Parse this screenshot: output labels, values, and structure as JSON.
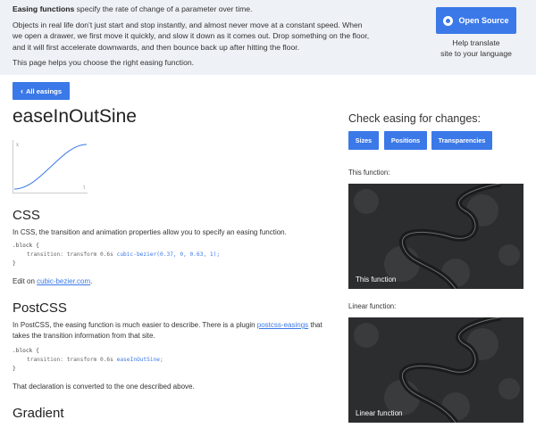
{
  "header": {
    "intro_bold": "Easing functions",
    "intro_rest": " specify the rate of change of a parameter over time.",
    "para1": "Objects in real life don’t just start and stop instantly, and almost never move at a constant speed. When we open a drawer, we first move it quickly, and slow it down as it comes out. Drop something on the floor, and it will first accelerate downwards, and then bounce back up after hitting the floor.",
    "para2": "This page helps you choose the right easing function.",
    "open_source_label": "Open Source",
    "github_icon": "github-icon",
    "translate_line1": "Help translate",
    "translate_line2": "site to your language"
  },
  "nav": {
    "back_label": "All easings",
    "back_icon": "chevron-left-icon"
  },
  "page_title": "easeInOutSine",
  "graph": {
    "x_label": "x",
    "t_label": "t",
    "curve_color": "#3b79e8"
  },
  "css": {
    "heading": "CSS",
    "text": "In CSS, the transition and animation properties allow you to specify an easing function.",
    "code_line1": ".block {",
    "code_line2_prop": "transition: transform 0.6s ",
    "code_line2_fn": "cubic-bezier(0.37, 0, 0.63, 1);",
    "code_line3": "}",
    "edit_prefix": "Edit on ",
    "edit_link": "cubic-bezier.com",
    "edit_suffix": "."
  },
  "postcss": {
    "heading": "PostCSS",
    "text_prefix": "In PostCSS, the easing function is much easier to describe. There is a plugin ",
    "plugin_link": "postcss-easings",
    "text_suffix": " that takes the transition information from that site.",
    "code_line1": ".block {",
    "code_line2_prop": "transition: transform 0.6s ",
    "code_line2_fn": "easeInOutSine;",
    "code_line3": "}",
    "after": "That declaration is converted to the one described above."
  },
  "gradient": {
    "heading": "Gradient"
  },
  "check": {
    "title": "Check easing for changes:",
    "buttons": [
      "Sizes",
      "Positions",
      "Transparencies"
    ]
  },
  "demos": {
    "this_label": "This function:",
    "this_caption": "This function",
    "linear_label": "Linear function:",
    "linear_caption": "Linear function"
  },
  "colors": {
    "accent": "#3b79e8",
    "header_bg": "#eef1f6"
  }
}
